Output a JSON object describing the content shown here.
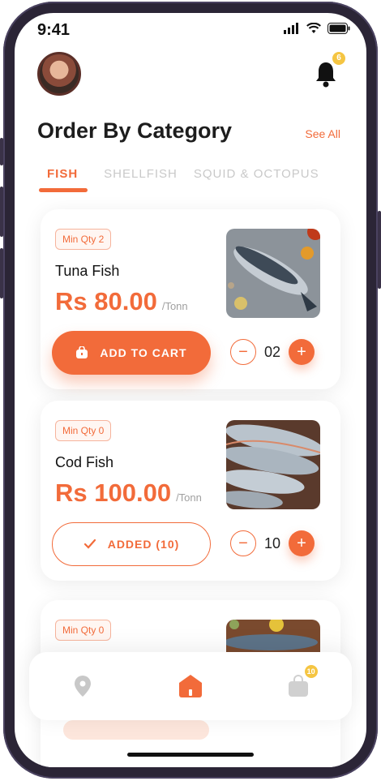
{
  "status_bar": {
    "time": "9:41"
  },
  "header": {
    "notification_count": "6"
  },
  "section": {
    "title": "Order By Category",
    "see_all": "See All"
  },
  "tabs": [
    {
      "label": "FISH",
      "active": true
    },
    {
      "label": "SHELLFISH",
      "active": false
    },
    {
      "label": "SQUID & OCTOPUS",
      "active": false
    }
  ],
  "products": [
    {
      "min_qty": "Min Qty 2",
      "name": "Tuna Fish",
      "price": "Rs 80.00",
      "unit": "/Tonn",
      "button": "ADD TO CART",
      "quantity": "02"
    },
    {
      "min_qty": "Min Qty 0",
      "name": "Cod Fish",
      "price": "Rs 100.00",
      "unit": "/Tonn",
      "button": "ADDED (10)",
      "quantity": "10"
    },
    {
      "min_qty": "Min Qty 0"
    }
  ],
  "bottom_nav": {
    "cart_count": "10"
  },
  "colors": {
    "accent": "#f26b3a",
    "badge": "#f5c542"
  }
}
